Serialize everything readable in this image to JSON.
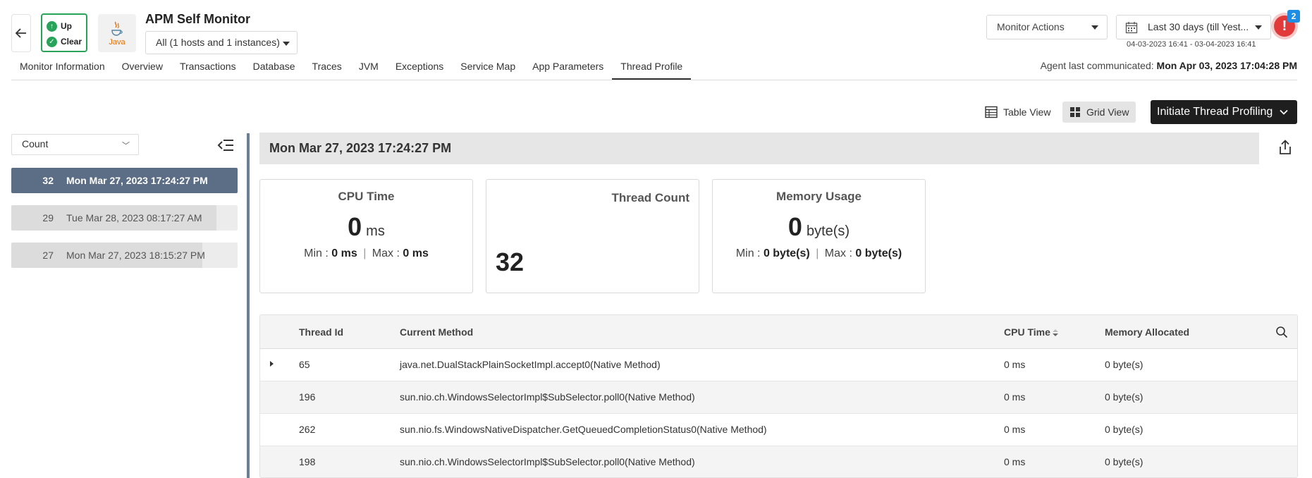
{
  "header": {
    "status_up": "Up",
    "status_clear": "Clear",
    "java_label": "Java",
    "monitor_title": "APM Self Monitor",
    "hosts_selector": "All (1 hosts and 1 instances)",
    "monitor_actions": "Monitor Actions",
    "date_selector": "Last 30 days (till Yest...",
    "date_range": "04-03-2023 16:41 - 03-04-2023 16:41",
    "alarm_symbol": "!",
    "alarm_count": "2",
    "status_color": "#2aa35a",
    "alarm_color": "#e23a3a"
  },
  "tabs": [
    {
      "label": "Monitor Information"
    },
    {
      "label": "Overview"
    },
    {
      "label": "Transactions"
    },
    {
      "label": "Database"
    },
    {
      "label": "Traces"
    },
    {
      "label": "JVM"
    },
    {
      "label": "Exceptions"
    },
    {
      "label": "Service Map"
    },
    {
      "label": "App Parameters"
    },
    {
      "label": "Thread Profile",
      "active": true
    }
  ],
  "agent": {
    "label": "Agent last communicated:",
    "value": "Mon Apr 03, 2023 17:04:28 PM"
  },
  "views": {
    "table_view": "Table View",
    "grid_view": "Grid View",
    "initiate": "Initiate Thread Profiling"
  },
  "left_panel": {
    "sort_select": "Count",
    "snapshots": [
      {
        "count": "32",
        "datetime": "Mon Mar 27, 2023 17:24:27 PM",
        "fill": 1.0,
        "selected": true
      },
      {
        "count": "29",
        "datetime": "Tue Mar 28, 2023 08:17:27 AM",
        "fill": 0.906,
        "selected": false
      },
      {
        "count": "27",
        "datetime": "Mon Mar 27, 2023 18:15:27 PM",
        "fill": 0.844,
        "selected": false
      }
    ]
  },
  "snapshot": {
    "title": "Mon Mar 27, 2023 17:24:27 PM",
    "cpu": {
      "title": "CPU Time",
      "value": "0",
      "unit": "ms",
      "min_label": "Min :",
      "min_value": "0 ms",
      "max_label": "Max :",
      "max_value": "0 ms",
      "separator": "|"
    },
    "threads": {
      "title": "Thread Count",
      "value": "32"
    },
    "memory": {
      "title": "Memory Usage",
      "value": "0",
      "unit": "byte(s)",
      "min_label": "Min :",
      "min_value": "0 byte(s)",
      "max_label": "Max :",
      "max_value": "0 byte(s)",
      "separator": "|"
    }
  },
  "table": {
    "columns": {
      "thread_id": "Thread Id",
      "current_method": "Current Method",
      "cpu_time": "CPU Time",
      "memory_allocated": "Memory Allocated"
    },
    "rows": [
      {
        "thread_id": "65",
        "method": "java.net.DualStackPlainSocketImpl.accept0(Native Method)",
        "cpu": "0 ms",
        "memory": "0 byte(s)"
      },
      {
        "thread_id": "196",
        "method": "sun.nio.ch.WindowsSelectorImpl$SubSelector.poll0(Native Method)",
        "cpu": "0 ms",
        "memory": "0 byte(s)"
      },
      {
        "thread_id": "262",
        "method": "sun.nio.fs.WindowsNativeDispatcher.GetQueuedCompletionStatus0(Native Method)",
        "cpu": "0 ms",
        "memory": "0 byte(s)"
      },
      {
        "thread_id": "198",
        "method": "sun.nio.ch.WindowsSelectorImpl$SubSelector.poll0(Native Method)",
        "cpu": "0 ms",
        "memory": "0 byte(s)"
      }
    ]
  }
}
